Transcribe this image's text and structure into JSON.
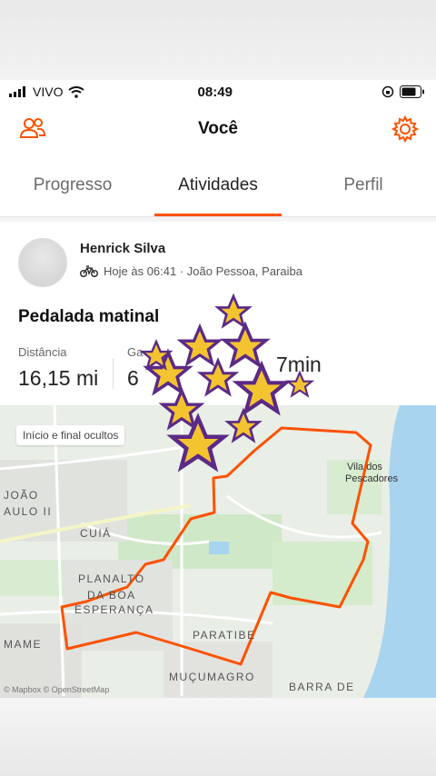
{
  "status_bar": {
    "carrier": "VIVO",
    "time": "08:49"
  },
  "app_bar": {
    "title": "Você",
    "left_icon": "friends-icon",
    "right_icon": "gear-icon"
  },
  "tabs": [
    {
      "label": "Progresso",
      "active": false
    },
    {
      "label": "Atividades",
      "active": true
    },
    {
      "label": "Perfil",
      "active": false
    }
  ],
  "activity": {
    "athlete_name": "Henrick Silva",
    "activity_icon": "bike-icon",
    "timestamp_location": "Hoje às 06:41 · João Pessoa, Paraiba",
    "title": "Pedalada matinal",
    "stats": [
      {
        "label": "Distância",
        "value": "16,15 mi"
      },
      {
        "label": "Ga",
        "value": "6"
      },
      {
        "label": "",
        "value": "7min"
      }
    ]
  },
  "map": {
    "privacy_chip": "Início e final ocultos",
    "labels": {
      "joao": "JOÃO",
      "paulo": "AULO II",
      "cuia": "CUIÁ",
      "planalto": "PLANALTO",
      "dabo": "DA BOA",
      "esperanca": "ESPERANÇA",
      "mame": "MAME",
      "paratibe": "PARATIBE",
      "mucumagro": "MUÇUMAGRO",
      "barra": "BARRA DE",
      "vila1": "Vila dos",
      "vila2": "Pescadores"
    },
    "attribution": "© Mapbox © OpenStreetMap",
    "route_color": "#fc5200"
  }
}
